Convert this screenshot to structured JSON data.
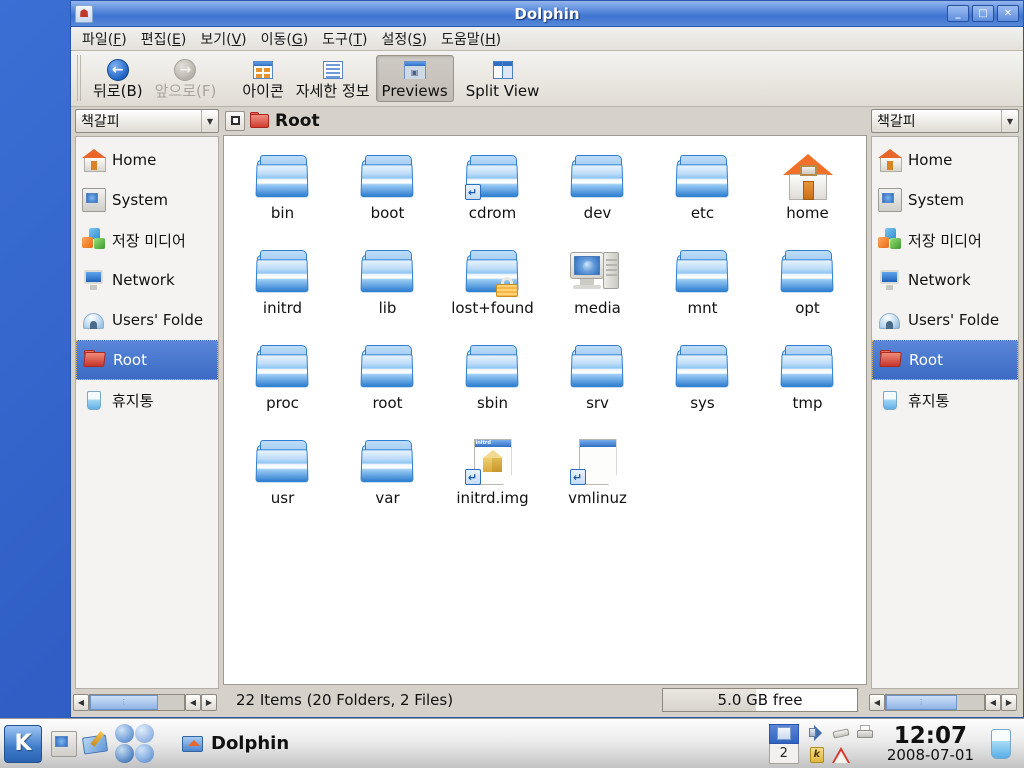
{
  "window": {
    "title": "Dolphin",
    "icon": "folder-home-icon",
    "buttons": {
      "minimize": "_",
      "maximize": "□",
      "close": "✕"
    }
  },
  "menubar": {
    "items": [
      {
        "pre": "파일(",
        "key": "F",
        "post": ")"
      },
      {
        "pre": "편집(",
        "key": "E",
        "post": ")"
      },
      {
        "pre": "보기(",
        "key": "V",
        "post": ")"
      },
      {
        "pre": "이동(",
        "key": "G",
        "post": ")"
      },
      {
        "pre": "도구(",
        "key": "T",
        "post": ")"
      },
      {
        "pre": "설정(",
        "key": "S",
        "post": ")"
      },
      {
        "pre": "도움말(",
        "key": "H",
        "post": ")"
      }
    ]
  },
  "toolbar": {
    "back_label": "뒤로(B)",
    "forward_label": "앞으로(F)",
    "icons_label": "아이콘",
    "details_label": "자세한 정보",
    "previews_label": "Previews",
    "splitview_label": "Split View",
    "previews_pressed": true,
    "forward_disabled": true
  },
  "sidebar_left": {
    "combo_label": "책갈피",
    "items": [
      {
        "label": "Home",
        "icon": "house-icon"
      },
      {
        "label": "System",
        "icon": "computer-icon"
      },
      {
        "label": "저장 미디어",
        "icon": "storage-media-icon"
      },
      {
        "label": "Network",
        "icon": "network-icon"
      },
      {
        "label": "Users' Folde",
        "icon": "users-folder-icon"
      },
      {
        "label": "Root",
        "icon": "root-folder-icon",
        "selected": true
      },
      {
        "label": "휴지통",
        "icon": "trash-icon"
      }
    ]
  },
  "sidebar_right": {
    "combo_label": "책갈피",
    "items": [
      {
        "label": "Home",
        "icon": "house-icon"
      },
      {
        "label": "System",
        "icon": "computer-icon"
      },
      {
        "label": "저장 미디어",
        "icon": "storage-media-icon"
      },
      {
        "label": "Network",
        "icon": "network-icon"
      },
      {
        "label": "Users' Folde",
        "icon": "users-folder-icon"
      },
      {
        "label": "Root",
        "icon": "root-folder-icon",
        "selected": true
      },
      {
        "label": "휴지통",
        "icon": "trash-icon"
      }
    ]
  },
  "location": {
    "toggle_icon": "edit-location-icon",
    "folder_icon": "red-folder-icon",
    "path_label": "Root"
  },
  "files": [
    {
      "name": "bin",
      "type": "folder"
    },
    {
      "name": "boot",
      "type": "folder"
    },
    {
      "name": "cdrom",
      "type": "folder",
      "overlay": "symlink"
    },
    {
      "name": "dev",
      "type": "folder"
    },
    {
      "name": "etc",
      "type": "folder"
    },
    {
      "name": "home",
      "type": "home-folder"
    },
    {
      "name": "initrd",
      "type": "folder"
    },
    {
      "name": "lib",
      "type": "folder"
    },
    {
      "name": "lost+found",
      "type": "folder",
      "overlay": "lock"
    },
    {
      "name": "media",
      "type": "computer-folder"
    },
    {
      "name": "mnt",
      "type": "folder"
    },
    {
      "name": "opt",
      "type": "folder"
    },
    {
      "name": "proc",
      "type": "folder"
    },
    {
      "name": "root",
      "type": "folder"
    },
    {
      "name": "sbin",
      "type": "folder"
    },
    {
      "name": "srv",
      "type": "folder"
    },
    {
      "name": "sys",
      "type": "folder"
    },
    {
      "name": "tmp",
      "type": "folder"
    },
    {
      "name": "usr",
      "type": "folder"
    },
    {
      "name": "var",
      "type": "folder"
    },
    {
      "name": "initrd.img",
      "type": "file-archive",
      "overlay": "symlink",
      "thumb_title": "initrd"
    },
    {
      "name": "vmlinuz",
      "type": "file-blank",
      "overlay": "symlink",
      "thumb_title": ""
    }
  ],
  "statusbar": {
    "items_text": "22 Items (20 Folders, 2 Files)",
    "free_space": "5.0 GB free"
  },
  "taskbar": {
    "kmenu_label": "K",
    "quicklaunch": [
      "computer-icon",
      "text-editor-icon",
      "apps-group-icon"
    ],
    "task_entries": [
      {
        "label": "Dolphin",
        "icon": "folder-home-icon"
      }
    ],
    "pager_desktop": "2",
    "tray_icons": [
      "volume-icon",
      "usb-icon",
      "printer-icon",
      "klipper-icon",
      "update-warning-icon"
    ],
    "clock_time": "12:07",
    "clock_date": "2008-07-01",
    "trash_icon": "trash-icon"
  },
  "colors": {
    "titlebar_blue": "#3f74d0",
    "selection_blue": "#3a6bc4",
    "folder_blue": "#2f7fd0",
    "desktop_blue": "#3566cc",
    "accent_orange": "#e8662a"
  }
}
